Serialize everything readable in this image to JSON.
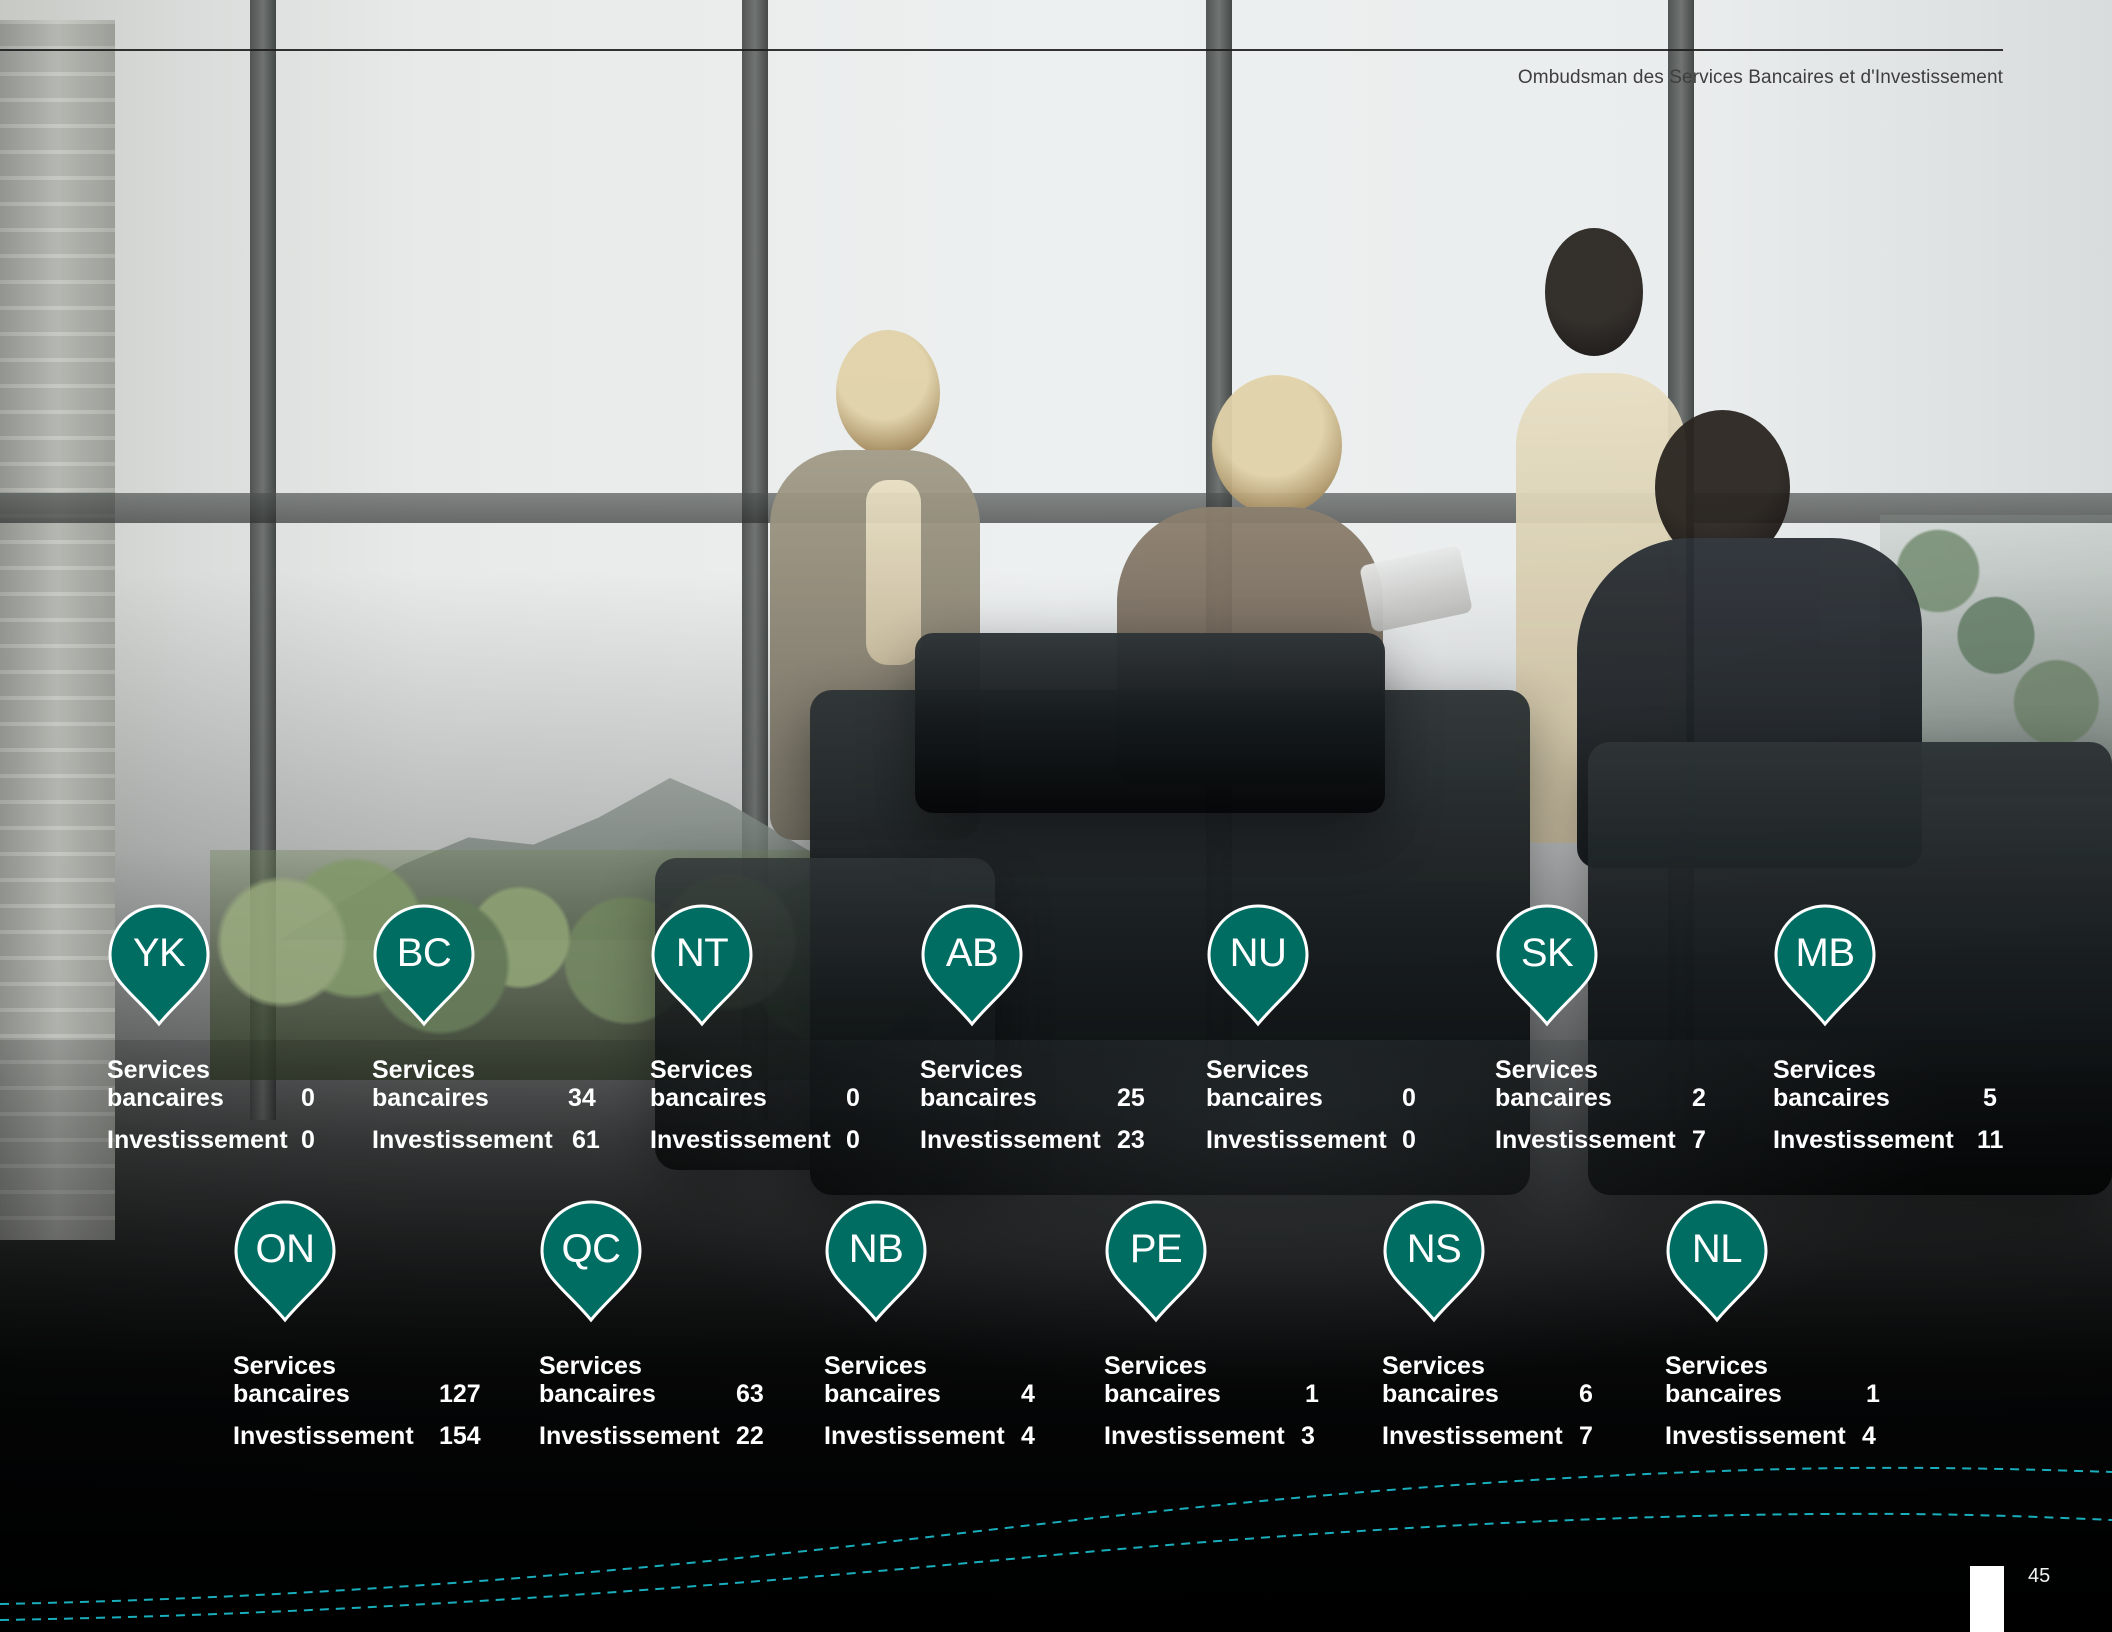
{
  "header": {
    "organization": "Ombudsman des Services Bancaires et d'Investissement"
  },
  "footer": {
    "page_number": "45"
  },
  "colors": {
    "pin": "#006d63",
    "text": "#ffffff",
    "accent_wave": "#1ab7c6"
  },
  "labels": {
    "services": "Services bancaires",
    "investments": "Investissement"
  },
  "regions": [
    {
      "code": "YK",
      "services": "0",
      "investments": "0"
    },
    {
      "code": "BC",
      "services": "34",
      "investments": "61"
    },
    {
      "code": "NT",
      "services": "0",
      "investments": "0"
    },
    {
      "code": "AB",
      "services": "25",
      "investments": "23"
    },
    {
      "code": "NU",
      "services": "0",
      "investments": "0"
    },
    {
      "code": "SK",
      "services": "2",
      "investments": "7"
    },
    {
      "code": "MB",
      "services": "5",
      "investments": "11"
    },
    {
      "code": "ON",
      "services": "127",
      "investments": "154"
    },
    {
      "code": "QC",
      "services": "63",
      "investments": "22"
    },
    {
      "code": "NB",
      "services": "4",
      "investments": "4"
    },
    {
      "code": "PE",
      "services": "1",
      "investments": "3"
    },
    {
      "code": "NS",
      "services": "6",
      "investments": "7"
    },
    {
      "code": "NL",
      "services": "1",
      "investments": "4"
    }
  ]
}
